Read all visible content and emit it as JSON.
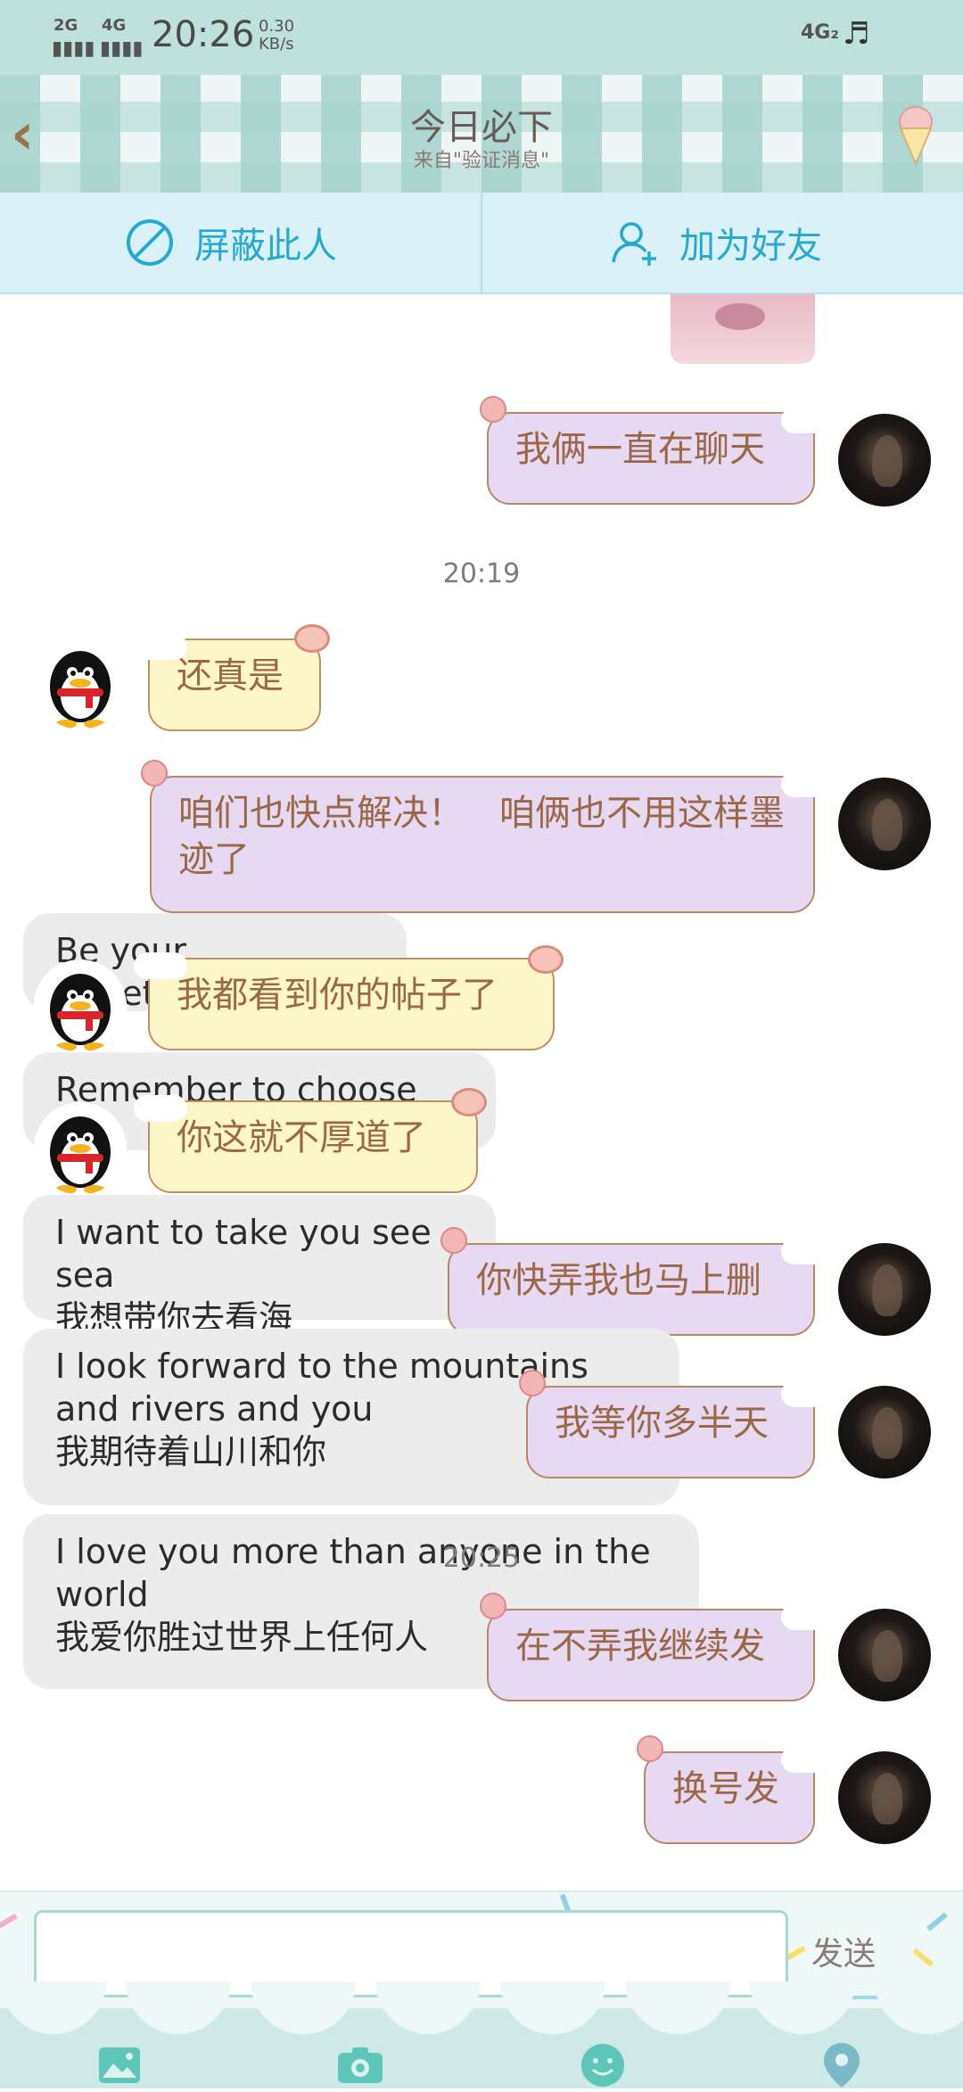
{
  "status_bar": {
    "signal1": "2G",
    "signal2": "4G",
    "time": "20:26",
    "speed_value": "0.30",
    "speed_unit": "KB/s",
    "network": "4G₂"
  },
  "header": {
    "title": "今日必下",
    "subtitle": "来自\"验证消息\""
  },
  "actions": {
    "block_label": "屏蔽此人",
    "add_friend_label": "加为好友"
  },
  "messages": {
    "m1": "我俩一直在聊天",
    "ts1": "20:19",
    "m2": "还真是",
    "m3": "咱们也快点解决！　咱俩也不用这样墨迹了",
    "m4": "我都看到你的帖子了",
    "m5": "你这就不厚道了",
    "m6": "你快弄我也马上删",
    "m7": "我等你多半天",
    "ts2": "20:25",
    "m8": "在不弄我继续发",
    "m9": "换号发"
  },
  "background_cards": {
    "c1_en": "Be your sweetheart",
    "c2_en": "Remember to choose me",
    "c3_en": "I want to take you see sea",
    "c3_zh": "我想带你去看海",
    "c4_en": "I look forward to the mountains and rivers and you",
    "c4_zh": "我期待着山川和你",
    "c5_en": "I love you  more  than  anyone in  the world",
    "c5_zh": "我爱你胜过世界上任何人"
  },
  "input": {
    "placeholder": "",
    "send_label": "发送"
  },
  "toolbar_icons": [
    "image-icon",
    "camera-icon",
    "emoji-icon",
    "location-icon"
  ],
  "colors": {
    "accent_blue": "#24a9cf",
    "bubble_purple": "#e7d9f1",
    "bubble_yellow": "#fdf6c8",
    "bubble_text": "#9a6848",
    "header_teal": "#bfe1dc"
  }
}
